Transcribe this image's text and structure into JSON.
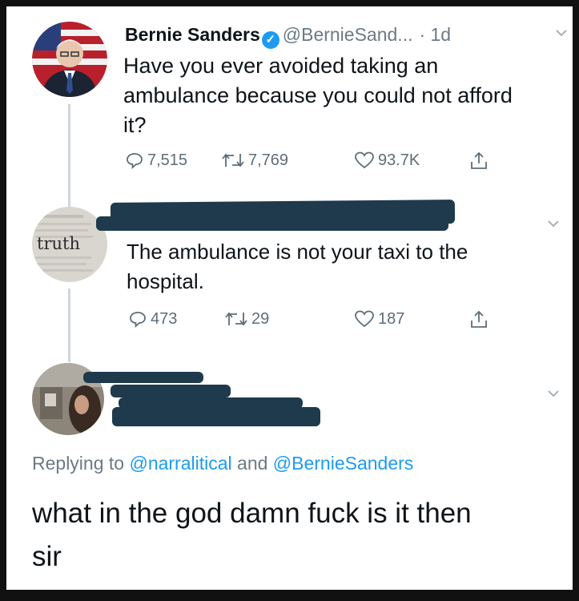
{
  "tweets": [
    {
      "name": "Bernie Sanders",
      "handle": "@BernieSand...",
      "time": "· 1d",
      "verified": true,
      "text_lines": [
        "Have you ever avoided taking an",
        "ambulance because you could not afford",
        "it?"
      ],
      "stats": {
        "replies": "7,515",
        "retweets": "7,769",
        "likes": "93.7K"
      }
    },
    {
      "avatar_label": "truth",
      "text_lines": [
        "The ambulance is not your taxi to the",
        "hospital."
      ],
      "stats": {
        "replies": "473",
        "retweets": "29",
        "likes": "187"
      }
    }
  ],
  "reply": {
    "replying_prefix": "Replying to",
    "mention_1": "@narralitical",
    "conjunction": "and",
    "mention_2": "@BernieSanders",
    "text_lines": [
      "what in the god damn fuck is it then",
      "sir"
    ]
  },
  "icons": [
    "reply-icon",
    "retweet-icon",
    "like-icon",
    "share-icon",
    "verified-icon",
    "chevron-down-icon"
  ],
  "colors": {
    "link": "#1d9bf0",
    "muted": "#6b7a86",
    "redaction": "#1f3a4c"
  }
}
